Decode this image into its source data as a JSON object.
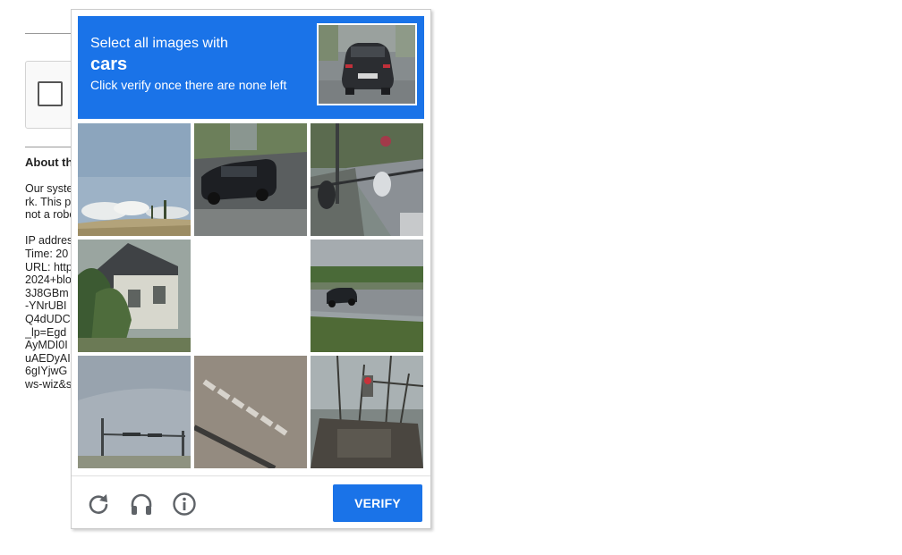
{
  "background_page": {
    "about_heading": "About th",
    "text_lines_1": [
      "Our syste",
      "rk. This p",
      "not a robo"
    ],
    "text_lines_2": [
      "IP addres",
      "Time: 20",
      "URL: http",
      "2024+blo",
      "3J8GBm",
      "-YNrUBI",
      "Q4dUDC",
      "_lp=Egd",
      "AyMDI0I",
      "uAEDyAI",
      "6gIYjwG",
      "ws-wiz&s"
    ]
  },
  "challenge": {
    "header": {
      "line1": "Select all images with",
      "target": "cars",
      "line3": "Click verify once there are none left"
    },
    "colors": {
      "accent": "#1a73e8",
      "footer_border": "#dfdfdf",
      "icon": "#5f6368"
    },
    "tiles": [
      {
        "index": 1,
        "content": "sky with clouds and field"
      },
      {
        "index": 2,
        "content": "dark suv on road"
      },
      {
        "index": 3,
        "content": "motorcycles near railing"
      },
      {
        "index": 4,
        "content": "house with palm trees"
      },
      {
        "index": 5,
        "content": "blank / loading"
      },
      {
        "index": 6,
        "content": "car on highway"
      },
      {
        "index": 7,
        "content": "sky with traffic light pole"
      },
      {
        "index": 8,
        "content": "crosswalk stripes"
      },
      {
        "index": 9,
        "content": "traffic light and trees"
      }
    ],
    "footer": {
      "reload_icon": "reload-icon",
      "audio_icon": "headphones-icon",
      "info_icon": "info-icon",
      "verify_label": "VERIFY"
    }
  }
}
